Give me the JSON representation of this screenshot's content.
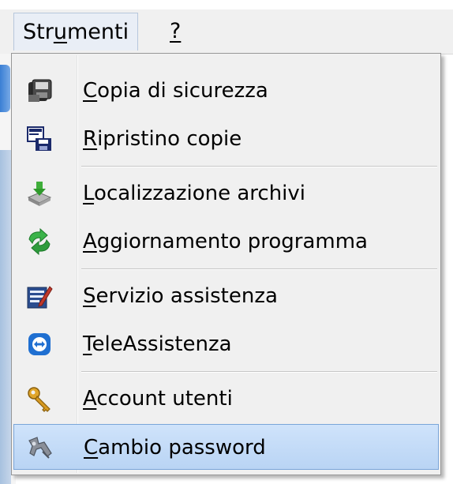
{
  "menubar": {
    "items": [
      {
        "prefix": "Str",
        "mnemonic": "u",
        "suffix": "menti"
      },
      {
        "prefix": "",
        "mnemonic": "?",
        "suffix": ""
      }
    ]
  },
  "menu": {
    "items": [
      {
        "mnemonic": "C",
        "rest": "opia di sicurezza",
        "icon": "backup-icon"
      },
      {
        "mnemonic": "R",
        "rest": "ipristino copie",
        "icon": "restore-icon"
      },
      {
        "mnemonic": "L",
        "rest": "ocalizzazione archivi",
        "icon": "archive-location-icon"
      },
      {
        "mnemonic": "A",
        "rest": "ggiornamento programma",
        "icon": "update-icon"
      },
      {
        "mnemonic": "S",
        "rest": "ervizio assistenza",
        "icon": "support-service-icon"
      },
      {
        "mnemonic": "T",
        "rest": "eleAssistenza",
        "icon": "teleassistance-icon"
      },
      {
        "mnemonic": "A",
        "rest": "ccount utenti",
        "icon": "user-accounts-key-icon"
      },
      {
        "mnemonic": "C",
        "rest": "ambio password",
        "icon": "change-password-icon"
      }
    ]
  },
  "colors": {
    "highlight": "#cfe3fb",
    "highlight_border": "#7aa5d8",
    "menu_bg": "#f0f0f0"
  }
}
